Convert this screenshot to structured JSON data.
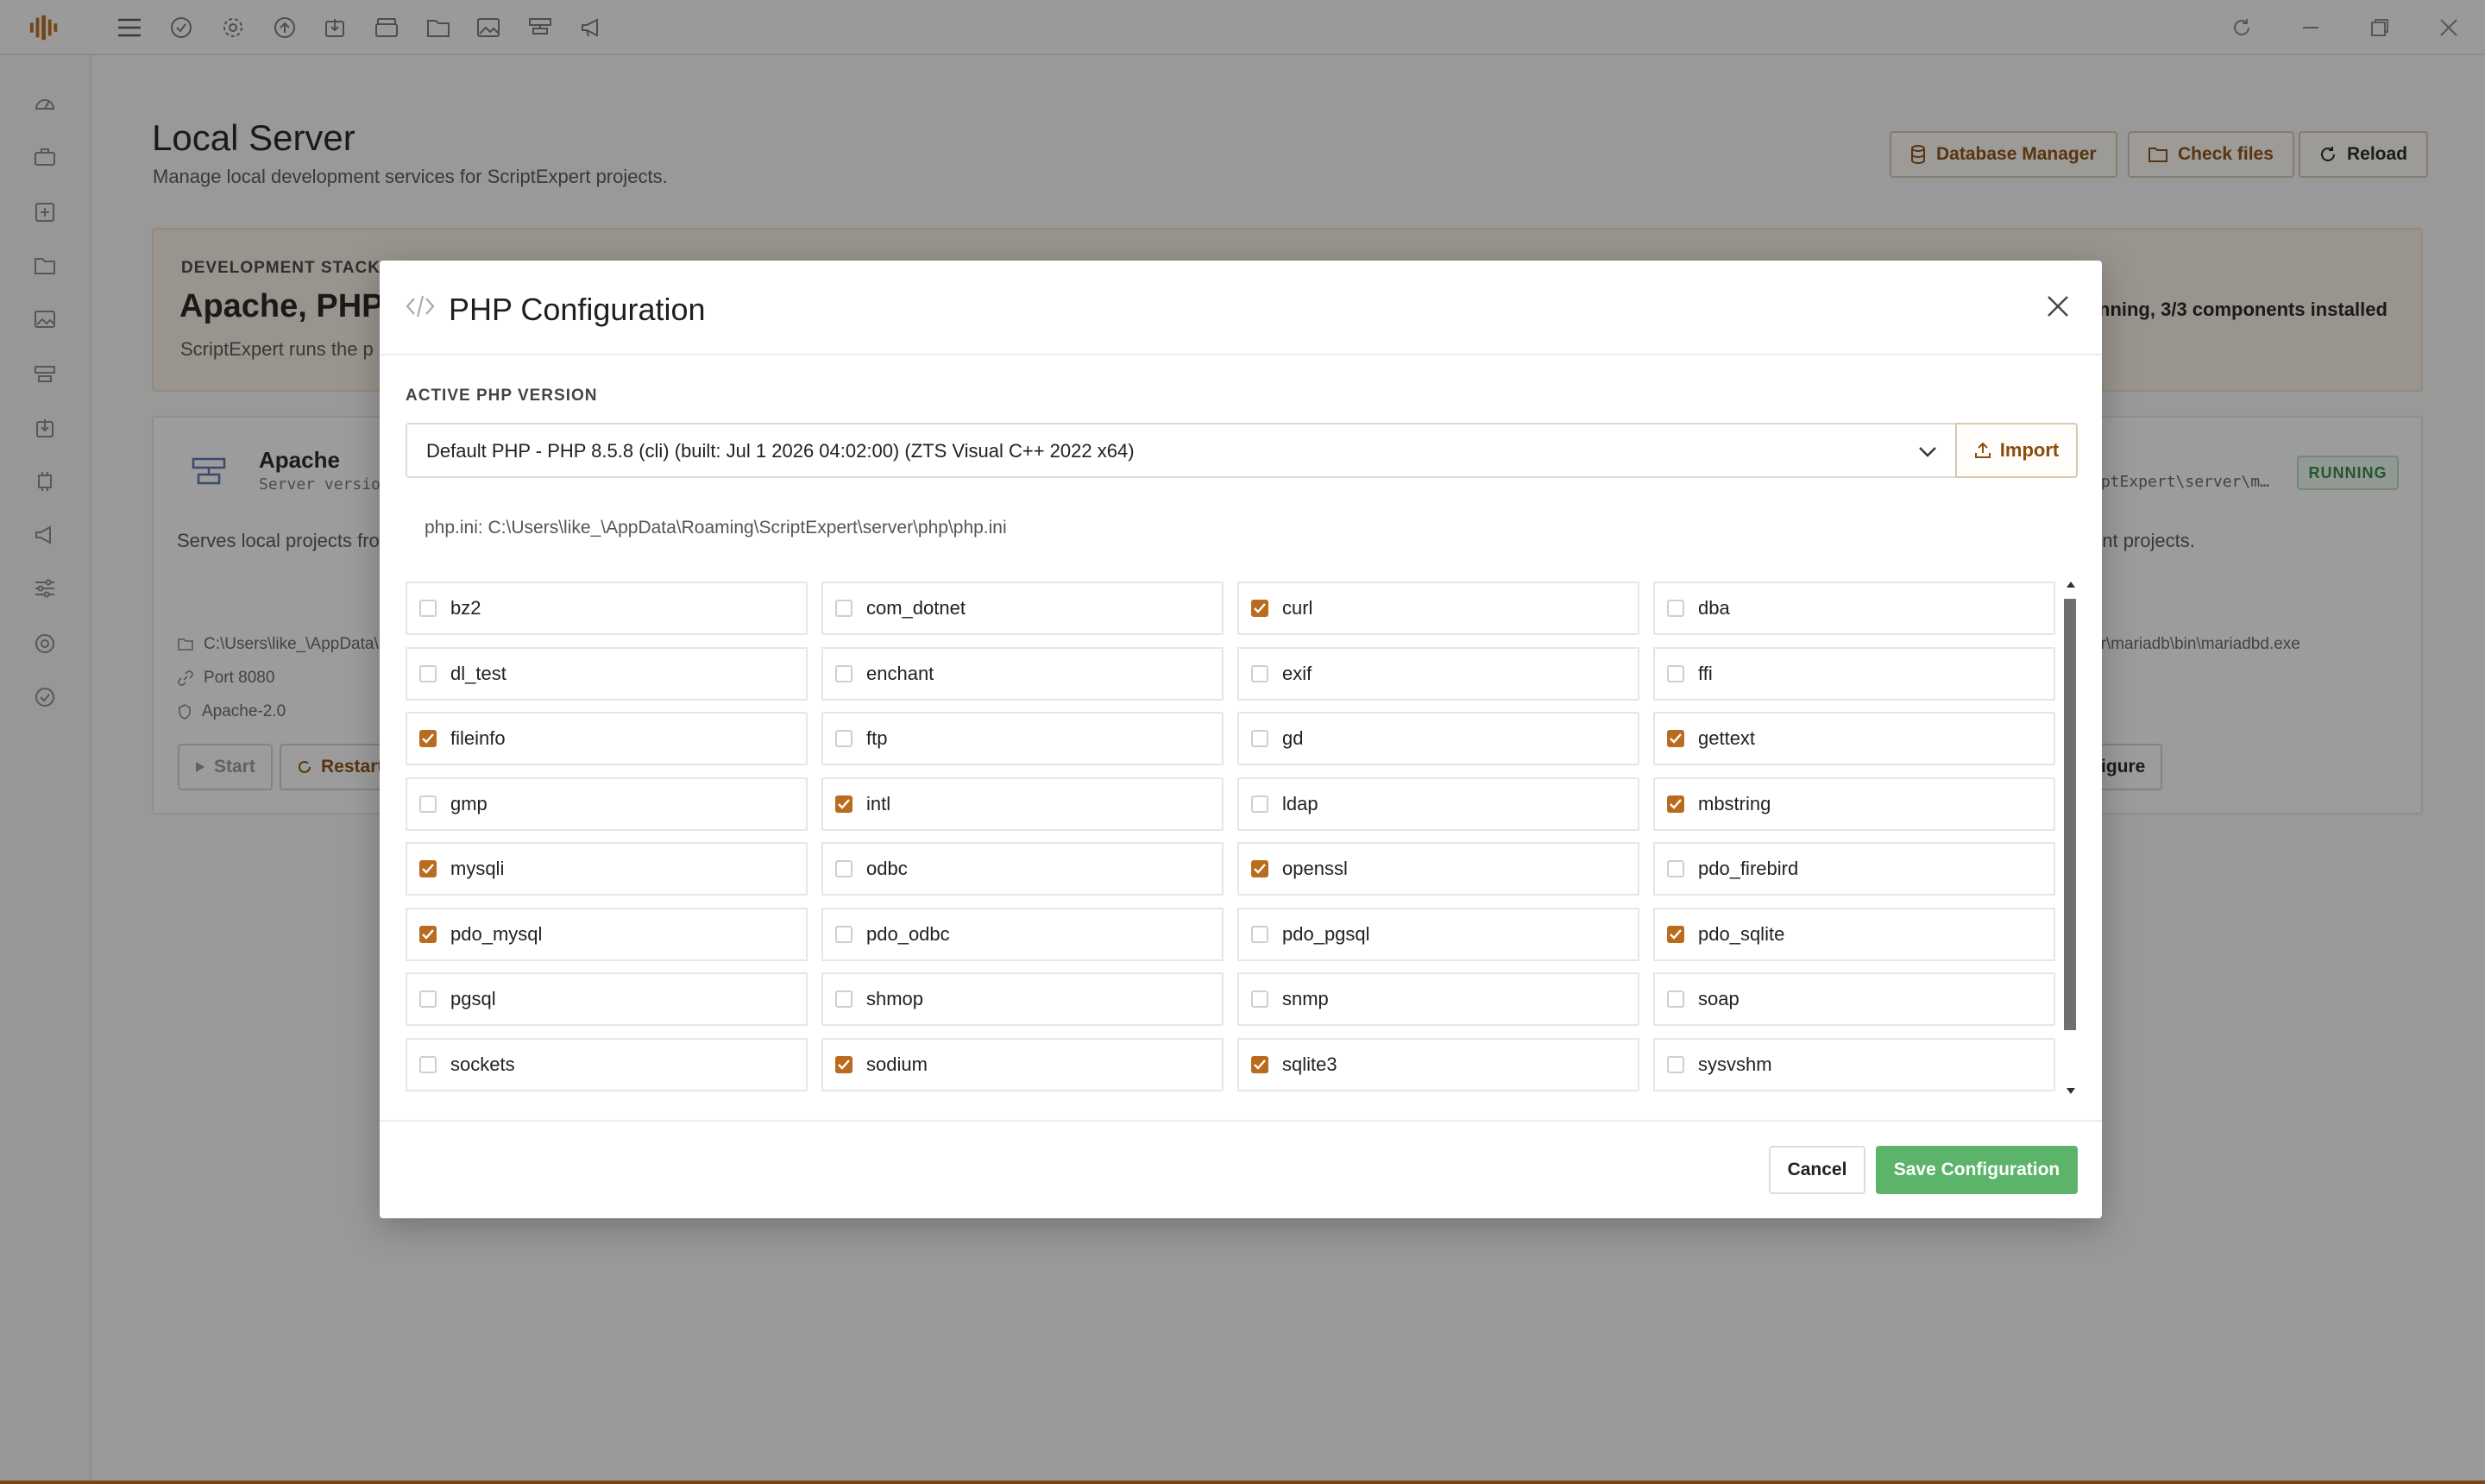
{
  "colors": {
    "accent": "#b96b1e",
    "success": "#5cb46b",
    "running": "#2f8a42"
  },
  "topbar": {
    "icons": [
      "logo-icon",
      "menu-icon",
      "check-circle-icon",
      "gear-icon",
      "upload-icon",
      "download-icon",
      "box-icon",
      "folder-icon",
      "image-icon",
      "server-icon",
      "megaphone-icon"
    ],
    "window_icons": [
      "refresh-icon",
      "minimize-icon",
      "maximize-icon",
      "close-icon"
    ]
  },
  "sidebar": {
    "icons": [
      "gauge-icon",
      "briefcase-icon",
      "plus-square-icon",
      "folder-icon",
      "image-icon",
      "server-icon",
      "download-icon",
      "cpu-icon",
      "megaphone-icon",
      "sliders-icon",
      "globe-icon",
      "check-circle-icon"
    ]
  },
  "header": {
    "title": "Local Server",
    "subtitle": "Manage local development services for ScriptExpert projects.",
    "buttons": {
      "database_manager": "Database Manager",
      "check_files": "Check files",
      "reload": "Reload"
    }
  },
  "stack": {
    "eyebrow": "DEVELOPMENT STACK",
    "title": "Apache, PHP",
    "description": "ScriptExpert runs the p",
    "status": "nning, 3/3 components installed"
  },
  "service": {
    "name": "Apache",
    "version": "Server versio",
    "description": "Serves local projects from",
    "path": "C:\\Users\\like_\\AppData\\",
    "port": "Port 8080",
    "license": "Apache-2.0",
    "start_label": "Start",
    "restart_label": "Restart",
    "right_path": "iptExpert\\server\\m…",
    "right_desc": "ent projects.",
    "right_exe": "er\\mariadb\\bin\\mariadbd.exe",
    "configure_label": "figure",
    "status": "RUNNING"
  },
  "modal": {
    "title": "PHP Configuration",
    "version_label": "ACTIVE PHP VERSION",
    "version_value": "Default PHP - PHP 8.5.8 (cli) (built: Jul 1 2026 04:02:00) (ZTS Visual C++ 2022 x64)",
    "import_label": "Import",
    "ini_path": "php.ini: C:\\Users\\like_\\AppData\\Roaming\\ScriptExpert\\server\\php\\php.ini",
    "extensions": [
      {
        "name": "bz2",
        "checked": false
      },
      {
        "name": "com_dotnet",
        "checked": false
      },
      {
        "name": "curl",
        "checked": true
      },
      {
        "name": "dba",
        "checked": false
      },
      {
        "name": "dl_test",
        "checked": false
      },
      {
        "name": "enchant",
        "checked": false
      },
      {
        "name": "exif",
        "checked": false
      },
      {
        "name": "ffi",
        "checked": false
      },
      {
        "name": "fileinfo",
        "checked": true
      },
      {
        "name": "ftp",
        "checked": false
      },
      {
        "name": "gd",
        "checked": false
      },
      {
        "name": "gettext",
        "checked": true
      },
      {
        "name": "gmp",
        "checked": false
      },
      {
        "name": "intl",
        "checked": true
      },
      {
        "name": "ldap",
        "checked": false
      },
      {
        "name": "mbstring",
        "checked": true
      },
      {
        "name": "mysqli",
        "checked": true
      },
      {
        "name": "odbc",
        "checked": false
      },
      {
        "name": "openssl",
        "checked": true
      },
      {
        "name": "pdo_firebird",
        "checked": false
      },
      {
        "name": "pdo_mysql",
        "checked": true
      },
      {
        "name": "pdo_odbc",
        "checked": false
      },
      {
        "name": "pdo_pgsql",
        "checked": false
      },
      {
        "name": "pdo_sqlite",
        "checked": true
      },
      {
        "name": "pgsql",
        "checked": false
      },
      {
        "name": "shmop",
        "checked": false
      },
      {
        "name": "snmp",
        "checked": false
      },
      {
        "name": "soap",
        "checked": false
      },
      {
        "name": "sockets",
        "checked": false
      },
      {
        "name": "sodium",
        "checked": true
      },
      {
        "name": "sqlite3",
        "checked": true
      },
      {
        "name": "sysvshm",
        "checked": false
      }
    ],
    "cancel_label": "Cancel",
    "save_label": "Save Configuration"
  }
}
